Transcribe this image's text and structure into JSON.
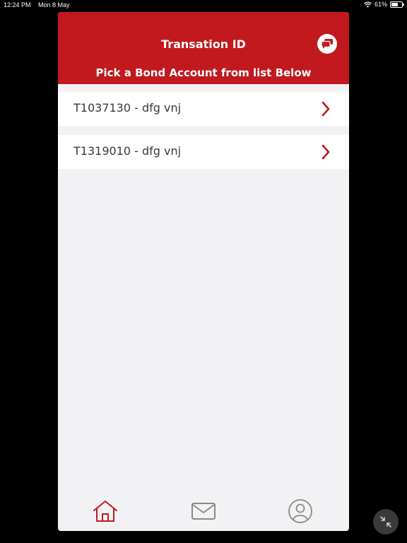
{
  "status_bar": {
    "time": "12:24 PM",
    "date": "Mon 8 May",
    "battery": "61%",
    "battery_level": 0.61,
    "icons": [
      "wifi-icon",
      "battery-icon"
    ]
  },
  "header": {
    "title": "Transation ID",
    "subtitle": "Pick a Bond Account from list Below",
    "chat_icon": "chat-icon"
  },
  "accounts": [
    {
      "label": "T1037130 - dfg vnj"
    },
    {
      "label": "T1319010 - dfg vnj"
    }
  ],
  "tabbar": {
    "items": [
      {
        "icon": "home-icon",
        "active": true
      },
      {
        "icon": "mail-icon",
        "active": false
      },
      {
        "icon": "profile-icon",
        "active": false
      }
    ]
  },
  "colors": {
    "brand": "#c1191e",
    "background": "#f2f2f4",
    "inactive_icon": "#8a8a8a"
  }
}
